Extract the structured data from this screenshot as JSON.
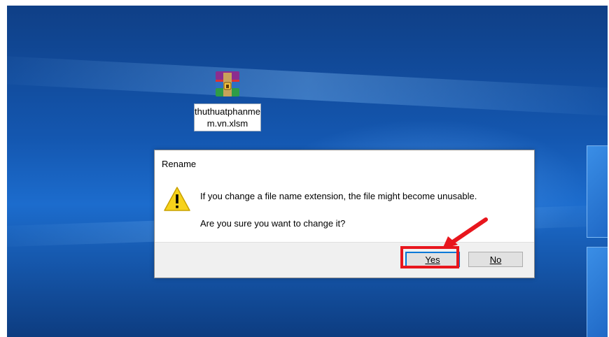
{
  "desktop": {
    "file": {
      "name": "thuthuatphanmem.vn.xlsm",
      "icon": "winrar-archive-icon"
    }
  },
  "dialog": {
    "title": "Rename",
    "icon": "warning-icon",
    "message": "If you change a file name extension, the file might become unusable.",
    "question": "Are you sure you want to change it?",
    "yes_label": "Yes",
    "no_label": "No"
  },
  "annotation": {
    "highlight_color": "#e8161d",
    "highlighted_button": "yes-button"
  },
  "colors": {
    "desktop_blue": "#1457b0",
    "accent": "#0078d7"
  }
}
